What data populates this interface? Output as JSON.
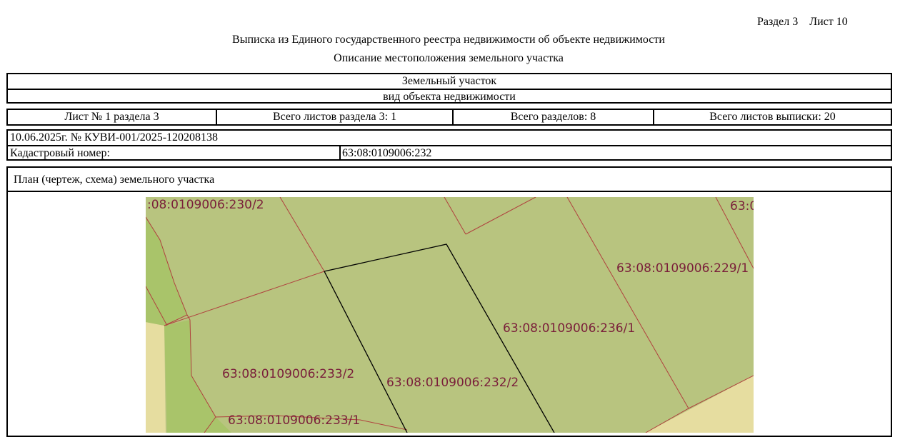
{
  "header": {
    "section": "Раздел 3",
    "sheet": "Лист 10",
    "title": "Выписка из Единого государственного реестра недвижимости об объекте недвижимости",
    "subtitle": "Описание местоположения земельного участка"
  },
  "object": {
    "type_value": "Земельный участок",
    "type_caption": "вид объекта недвижимости"
  },
  "sheets_row": [
    "Лист № 1 раздела 3",
    "Всего листов раздела 3: 1",
    "Всего разделов: 8",
    "Всего листов выписки: 20"
  ],
  "meta": {
    "date_number": "10.06.2025г. № КУВИ-001/2025-120208138",
    "cadastral_label": "Кадастровый номер:",
    "cadastral_value": "63:08:0109006:232"
  },
  "plan": {
    "heading": "План (чертеж, схема) земельного участка",
    "labels": {
      "l230_2": ":08:0109006:230/2",
      "l63": "63:0",
      "l229_1": "63:08:0109006:229/1",
      "l236_1": "63:08:0109006:236/1",
      "l233_2": "63:08:0109006:233/2",
      "l232_2": "63:08:0109006:232/2",
      "l233_1": "63:08:0109006:233/1"
    },
    "colors": {
      "parcel_fill": "#b8c47f",
      "light_fill": "#a9c46a",
      "sand_fill": "#e6dda0",
      "border_red": "#b0413e",
      "subject_border": "#000000",
      "label": "#7a1f3a"
    }
  }
}
